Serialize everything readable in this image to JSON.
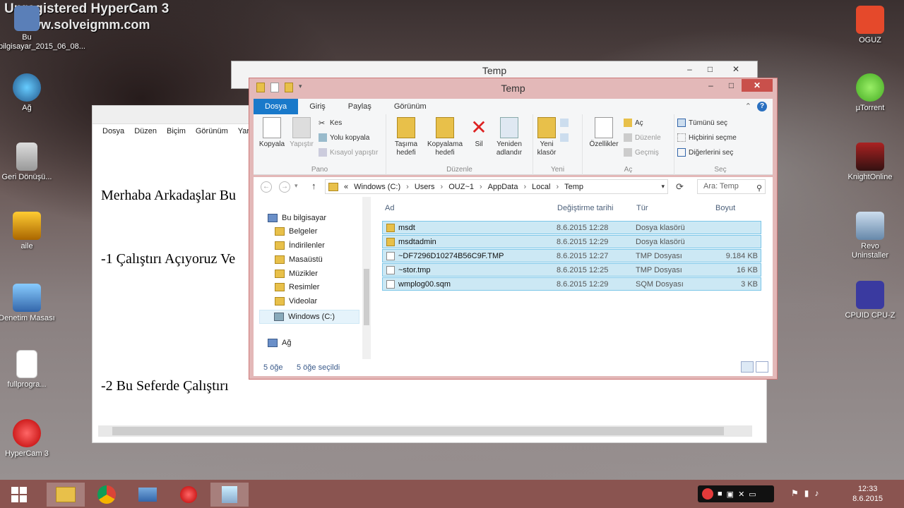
{
  "watermark": {
    "line1": "Unregistered HyperCam 3",
    "line2": "www.solveigmm.com"
  },
  "desktop_left": [
    {
      "label": "Bu bilgisayar_2015_06_08...",
      "icon": "computer-icon"
    },
    {
      "label": "Ağ",
      "icon": "network-icon"
    },
    {
      "label": "Geri Dönüşü...",
      "icon": "recycle-bin-icon"
    },
    {
      "label": "aile",
      "icon": "users-icon"
    },
    {
      "label": "Denetim Masası",
      "icon": "control-panel-icon"
    },
    {
      "label": "fullprogra...",
      "icon": "torrent-file-icon"
    },
    {
      "label": "HyperCam 3",
      "icon": "hypercam-icon"
    }
  ],
  "desktop_right": [
    {
      "label": "OGUZ",
      "icon": "power-icon"
    },
    {
      "label": "µTorrent",
      "icon": "utorrent-icon"
    },
    {
      "label": "KnightOnline",
      "icon": "game-icon"
    },
    {
      "label": "Revo Uninstaller",
      "icon": "revo-icon"
    },
    {
      "label": "CPUID CPU-Z",
      "icon": "cpuz-icon"
    }
  ],
  "back_window": {
    "title": "Temp"
  },
  "notepad": {
    "menu": [
      "Dosya",
      "Düzen",
      "Biçim",
      "Görünüm",
      "Yar"
    ],
    "lines": [
      "Merhaba Arkadaşlar Bu",
      "-1 Çalıştırı Açıyoruz Ve",
      "",
      "-2 Bu Seferde Çalıştırı"
    ]
  },
  "explorer": {
    "title": "Temp",
    "tabs": [
      "Dosya",
      "Giriş",
      "Paylaş",
      "Görünüm"
    ],
    "ribbon": {
      "pano": {
        "label": "Pano",
        "kopyala": "Kopyala",
        "yapistir": "Yapıştır",
        "kes": "Kes",
        "yol_kopyala": "Yolu kopyala",
        "kisayol": "Kısayol yapıştır"
      },
      "duzenle": {
        "label": "Düzenle",
        "tasima": "Taşıma hedefi",
        "kopyalama": "Kopyalama hedefi",
        "sil": "Sil",
        "yeniden": "Yeniden adlandır"
      },
      "yeni": {
        "label": "Yeni",
        "klasor": "Yeni klasör"
      },
      "ac": {
        "label": "Aç",
        "ozellikler": "Özellikler",
        "ac": "Aç",
        "duzenle": "Düzenle",
        "gecmis": "Geçmiş"
      },
      "sec": {
        "label": "Seç",
        "tumunu": "Tümünü seç",
        "hicbirini": "Hiçbirini seçme",
        "digerlerini": "Diğerlerini seç"
      }
    },
    "address": [
      "Windows (C:)",
      "Users",
      "OUZ~1",
      "AppData",
      "Local",
      "Temp"
    ],
    "address_prefix": "«",
    "search_placeholder": "Ara: Temp",
    "nav": [
      {
        "label": "Bu bilgisayar"
      },
      {
        "label": "Belgeler"
      },
      {
        "label": "İndirilenler"
      },
      {
        "label": "Masaüstü"
      },
      {
        "label": "Müzikler"
      },
      {
        "label": "Resimler"
      },
      {
        "label": "Videolar"
      },
      {
        "label": "Windows (C:)"
      },
      {
        "label": "Ağ"
      }
    ],
    "columns": {
      "name": "Ad",
      "date": "Değiştirme tarihi",
      "type": "Tür",
      "size": "Boyut"
    },
    "files": [
      {
        "name": "msdt",
        "date": "8.6.2015 12:28",
        "type": "Dosya klasörü",
        "size": "",
        "kind": "folder"
      },
      {
        "name": "msdtadmin",
        "date": "8.6.2015 12:29",
        "type": "Dosya klasörü",
        "size": "",
        "kind": "folder"
      },
      {
        "name": "~DF7296D10274B56C9F.TMP",
        "date": "8.6.2015 12:27",
        "type": "TMP Dosyası",
        "size": "9.184 KB",
        "kind": "file"
      },
      {
        "name": "~stor.tmp",
        "date": "8.6.2015 12:25",
        "type": "TMP Dosyası",
        "size": "16 KB",
        "kind": "file"
      },
      {
        "name": "wmplog00.sqm",
        "date": "8.6.2015 12:29",
        "type": "SQM Dosyası",
        "size": "3 KB",
        "kind": "file"
      }
    ],
    "status": {
      "count": "5 öğe",
      "selected": "5 öğe seçildi"
    }
  },
  "taskbar": {
    "time": "12:33",
    "date": "8.6.2015"
  },
  "colors": {
    "explorer_frame": "#e3b8b8",
    "taskbar": "#8a5450",
    "selection": "#cce8f4",
    "file_tab": "#1979ca"
  }
}
